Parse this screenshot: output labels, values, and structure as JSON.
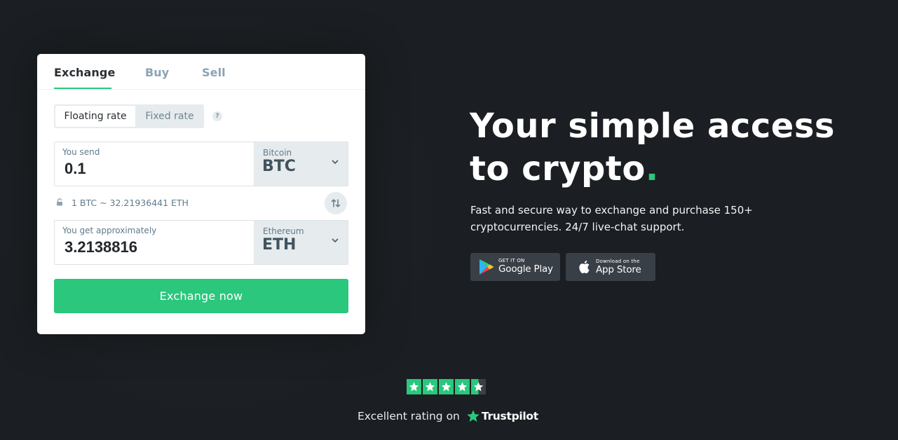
{
  "tabs": [
    {
      "label": "Exchange",
      "active": true
    },
    {
      "label": "Buy",
      "active": false
    },
    {
      "label": "Sell",
      "active": false
    }
  ],
  "rate_type": {
    "options": [
      "Floating rate",
      "Fixed rate"
    ],
    "selected": "Floating rate",
    "help_label": "?"
  },
  "send": {
    "label": "You send",
    "value": "0.1",
    "currency_name": "Bitcoin",
    "currency_code": "BTC"
  },
  "rate_text": "1 BTC ~ 32.21936441 ETH",
  "receive": {
    "label": "You get approximately",
    "value": "3.2138816",
    "currency_name": "Ethereum",
    "currency_code": "ETH"
  },
  "cta_label": "Exchange now",
  "hero": {
    "title_line1": "Your simple access",
    "title_line2": "to crypto",
    "title_dot": ".",
    "subtitle": "Fast and secure way to exchange and purchase 150+ cryptocurrencies. 24/7 live-chat support."
  },
  "stores": {
    "google": {
      "small": "GET IT ON",
      "big": "Google Play"
    },
    "apple": {
      "small": "Download on the",
      "big": "App Store"
    }
  },
  "rating": {
    "text": "Excellent rating on",
    "brand": "Trustpilot",
    "stars": 4.5
  },
  "colors": {
    "accent": "#2ac77c",
    "background": "#1b1e22",
    "card": "#ffffff"
  }
}
